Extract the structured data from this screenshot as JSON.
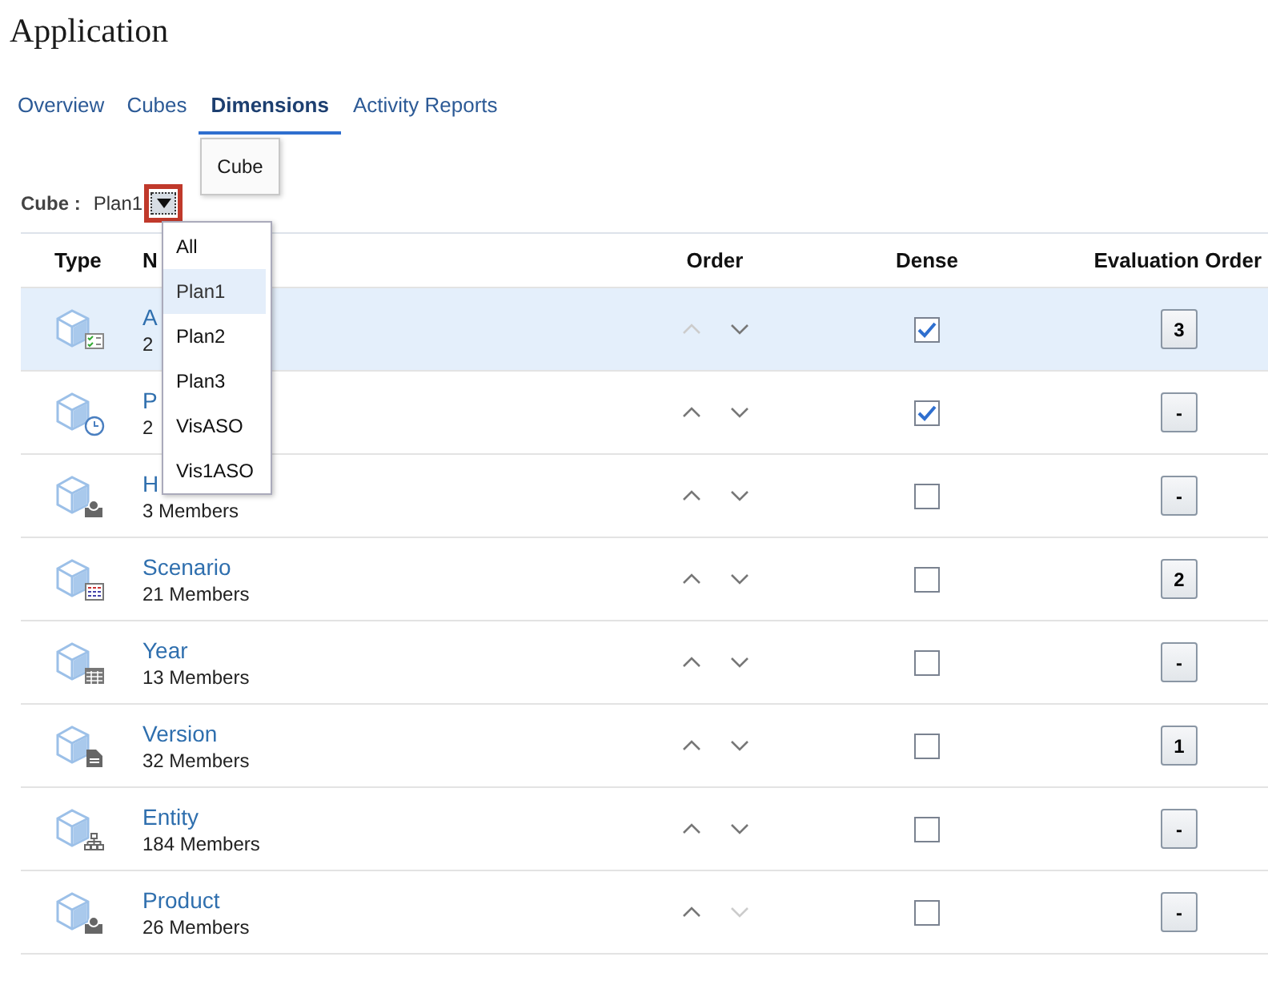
{
  "page": {
    "title": "Application"
  },
  "tabs": [
    {
      "label": "Overview",
      "selected": false
    },
    {
      "label": "Cubes",
      "selected": false
    },
    {
      "label": "Dimensions",
      "selected": true
    },
    {
      "label": "Activity Reports",
      "selected": false
    }
  ],
  "cube_filter": {
    "label": "Cube :",
    "value": "Plan1",
    "tooltip": "Cube",
    "focused": true
  },
  "dropdown": {
    "options": [
      {
        "label": "All",
        "selected": false
      },
      {
        "label": "Plan1",
        "selected": true
      },
      {
        "label": "Plan2",
        "selected": false
      },
      {
        "label": "Plan3",
        "selected": false
      },
      {
        "label": "VisASO",
        "selected": false
      },
      {
        "label": "Vis1ASO",
        "selected": false
      }
    ]
  },
  "table": {
    "columns": [
      "Type",
      "N",
      "Order",
      "Dense",
      "Evaluation Order"
    ],
    "rows": [
      {
        "name": "A",
        "members": "2",
        "kind": "checklist",
        "selected": true,
        "up_disabled": true,
        "down_disabled": false,
        "dense": true,
        "evaluation_order": "3"
      },
      {
        "name": "P",
        "members": "2",
        "kind": "clock",
        "selected": false,
        "up_disabled": false,
        "down_disabled": false,
        "dense": true,
        "evaluation_order": "-"
      },
      {
        "name": "H",
        "members": "3 Members",
        "kind": "person",
        "selected": false,
        "up_disabled": false,
        "down_disabled": false,
        "dense": false,
        "evaluation_order": "-"
      },
      {
        "name": "Scenario",
        "members": "21 Members",
        "kind": "grid",
        "selected": false,
        "up_disabled": false,
        "down_disabled": false,
        "dense": false,
        "evaluation_order": "2"
      },
      {
        "name": "Year",
        "members": "13 Members",
        "kind": "calendar",
        "selected": false,
        "up_disabled": false,
        "down_disabled": false,
        "dense": false,
        "evaluation_order": "-"
      },
      {
        "name": "Version",
        "members": "32 Members",
        "kind": "document",
        "selected": false,
        "up_disabled": false,
        "down_disabled": false,
        "dense": false,
        "evaluation_order": "1"
      },
      {
        "name": "Entity",
        "members": "184 Members",
        "kind": "hierarchy",
        "selected": false,
        "up_disabled": false,
        "down_disabled": false,
        "dense": false,
        "evaluation_order": "-"
      },
      {
        "name": "Product",
        "members": "26 Members",
        "kind": "person",
        "selected": false,
        "up_disabled": false,
        "down_disabled": true,
        "dense": false,
        "evaluation_order": "-"
      }
    ]
  }
}
